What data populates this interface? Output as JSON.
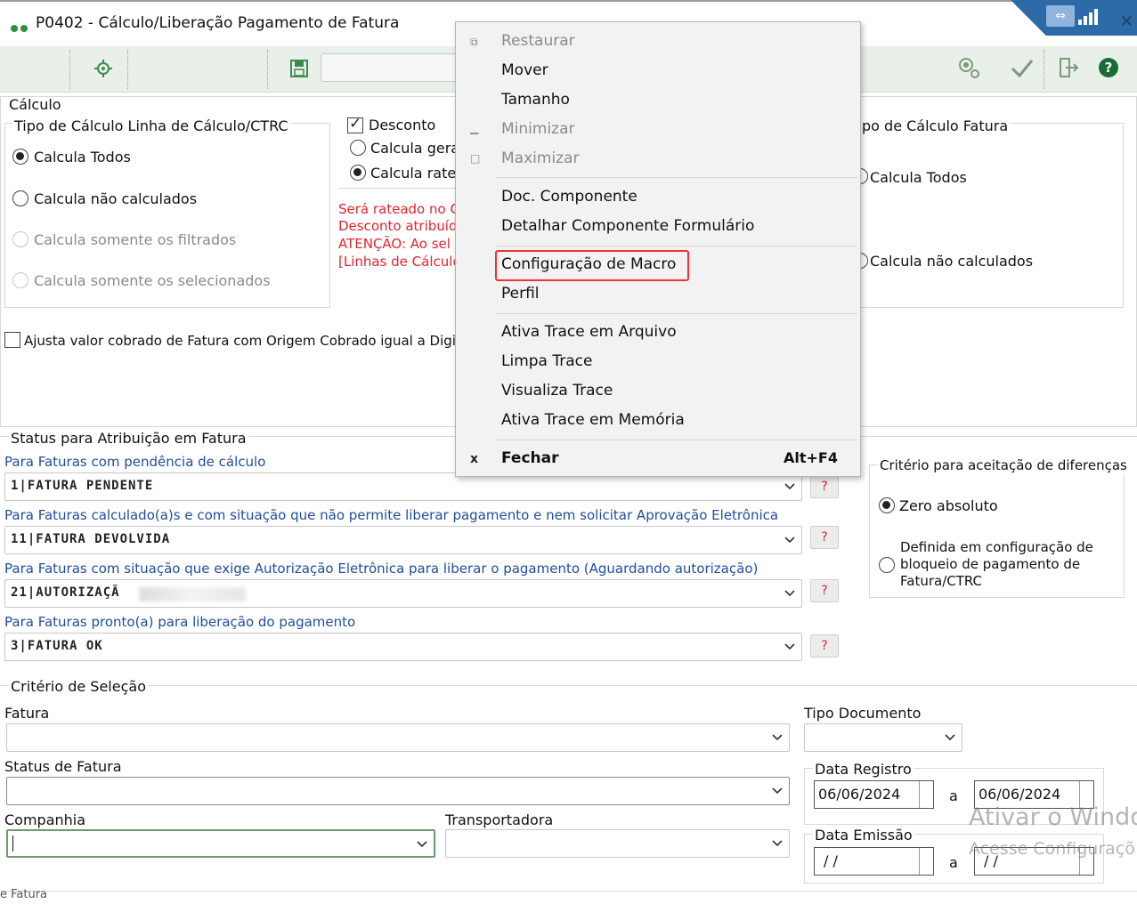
{
  "window": {
    "title": "P0402 - Cálculo/Liberação Pagamento de Fatura"
  },
  "calculo": {
    "section_title": "Cálculo",
    "tipo_linha": {
      "title": "Tipo de Cálculo Linha de Cálculo/CTRC",
      "options": [
        "Calcula Todos",
        "Calcula não calculados",
        "Calcula somente os filtrados",
        "Calcula somente os selecionados"
      ],
      "selected": "Calcula Todos"
    },
    "desconto": {
      "label": "Desconto",
      "checked": true,
      "options": [
        "Calcula gerar",
        "Calcula ratea"
      ],
      "selected": "Calcula ratea",
      "warnings": [
        "Será rateado no C",
        "Desconto atribuíd",
        "ATENÇÃO: Ao sel",
        "[Linhas de Cálculo"
      ]
    },
    "tipo_fatura": {
      "title": "po de Cálculo Fatura",
      "options": [
        "Calcula Todos",
        "Calcula não calculados"
      ]
    },
    "ajusta_checkbox": "Ajusta valor cobrado de Fatura com Origem Cobrado igual a Digitado"
  },
  "status": {
    "section_title": "Status para Atribuição em Fatura",
    "rows": [
      {
        "label": "Para Faturas com pendência de cálculo",
        "value": "1|FATURA PENDENTE",
        "help": "?"
      },
      {
        "label": "Para Faturas calculado(a)s e com situação que não permite liberar pagamento e nem solicitar Aprovação Eletrônica",
        "value": "11|FATURA DEVOLVIDA",
        "help": "?"
      },
      {
        "label": "Para Faturas com situação que exige Autorização Eletrônica para liberar o pagamento (Aguardando autorização)",
        "value": "21|AUTORIZAÇÃ",
        "help": "?"
      },
      {
        "label": "Para Faturas pronto(a) para liberação do pagamento",
        "value": "3|FATURA OK",
        "help": "?"
      }
    ]
  },
  "criterio_diferencas": {
    "title": "Critério para aceitação de diferenças",
    "options": [
      "Zero absoluto",
      "Definida em configuração de bloqueio de pagamento de Fatura/CTRC"
    ],
    "selected": "Zero absoluto"
  },
  "selecao": {
    "section_title": "Critério de Seleção",
    "fatura_label": "Fatura",
    "status_fatura_label": "Status de Fatura",
    "companhia_label": "Companhia",
    "transportadora_label": "Transportadora",
    "tipo_documento_label": "Tipo Documento",
    "data_registro_label": "Data Registro",
    "data_registro_from": "06/06/2024",
    "data_registro_to": "06/06/2024",
    "data_emissao_label": "Data Emissão",
    "data_emissao_from": "/ /",
    "data_emissao_to": "/ /",
    "range_sep": "a",
    "bottom_cut_label": "e Fatura"
  },
  "context_menu": {
    "items": [
      {
        "label": "Restaurar",
        "enabled": false,
        "icon": "restore-icon"
      },
      {
        "label": "Mover",
        "enabled": true
      },
      {
        "label": "Tamanho",
        "enabled": true
      },
      {
        "label": "Minimizar",
        "enabled": false,
        "icon": "minimize-icon"
      },
      {
        "label": "Maximizar",
        "enabled": false,
        "icon": "maximize-icon"
      },
      {
        "label": "Doc. Componente",
        "enabled": true
      },
      {
        "label": "Detalhar Componente Formulário",
        "enabled": true
      },
      {
        "label": "Configuração de Macro",
        "enabled": true,
        "highlighted": true
      },
      {
        "label": "Perfil",
        "enabled": true
      },
      {
        "label": "Ativa Trace em Arquivo",
        "enabled": true
      },
      {
        "label": "Limpa Trace",
        "enabled": true
      },
      {
        "label": "Visualiza Trace",
        "enabled": true
      },
      {
        "label": "Ativa Trace em Memória",
        "enabled": true
      },
      {
        "label": "Fechar",
        "enabled": true,
        "bold": true,
        "shortcut": "Alt+F4",
        "icon": "close-icon",
        "icon_glyph": "x"
      }
    ],
    "highlight_color": "#e33333"
  },
  "watermark": {
    "line1": "Ativar o Windo",
    "line2": "Acesse Configuraçõ"
  },
  "colors": {
    "accent_green": "#2f8f3a",
    "link_blue": "#1f4e9c",
    "warning_red": "#e0262f",
    "titlebar_blue": "#2d6aa8"
  }
}
